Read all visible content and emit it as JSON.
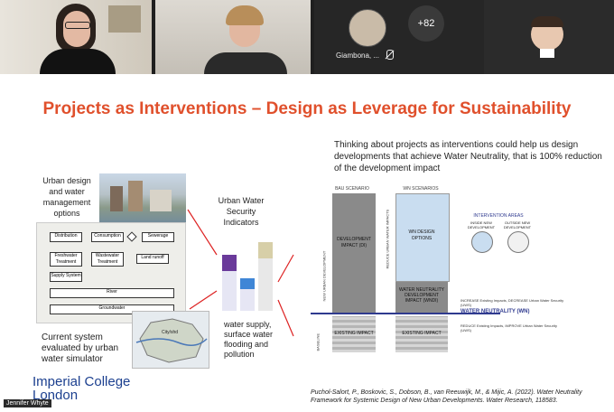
{
  "participants": {
    "others_count": "+82",
    "speaker_name": "Giambona, ...",
    "name_tag": "Jennifer Whyte"
  },
  "slide": {
    "title": "Projects as Interventions – Design as Leverage for Sustainability",
    "intro_text": "Thinking about projects as interventions could help us design developments that achieve Water Neutrality, that is 100% reduction of the development impact",
    "urban_design_label": "Urban design and water management options",
    "current_system_label": "Current system evaluated by urban water simulator",
    "indicators_title": "Urban Water Security Indicators",
    "indicators_caption": "water supply, surface water flooding and pollution",
    "flow_boxes": {
      "distribution": "Distribution",
      "consumption": "Consumption",
      "sewerage": "Sewerage",
      "freshwater": "Freshwater Treatment",
      "wastewater": "Wastewater Treatment",
      "land_runoff": "Land runoff",
      "supply_system": "Supply System",
      "river": "River",
      "groundwater": "Groundwater",
      "map_label": "City/shd"
    },
    "diagram": {
      "bau_scenario": "BAU SCENARIO",
      "wn_scenarios": "WN SCENARIOS",
      "development_impact": "DEVELOPMENT IMPACT (DI)",
      "wn_design_options": "WN DESIGN OPTIONS",
      "wn_dev_impact": "WATER NEUTRALITY DEVELOPMENT IMPACT (WNDI)",
      "existing_impact_1": "EXISTING IMPACT",
      "existing_impact_2": "EXISTING IMPACT",
      "new_urban_development": "NEW URBAN DEVELOPMENT",
      "reduce_impacts": "REDUCE URBAN WATER IMPACTS",
      "baseline": "BASELINE",
      "intervention_areas": "INTERVENTION AREAS",
      "inside_dev": "INSIDE NEW DEVELOPMENT",
      "outside_dev": "OUTSIDE NEW DEVELOPMENT",
      "wn_line_label": "WATER NEUTRALITY (WN)",
      "increase_text": "INCREASE Existing Impacts, DECREASE Urban Water Security (UWS)",
      "reduce_text": "REDUCE Existing Impacts, IMPROVE Urban Water Security (UWS)"
    },
    "citation": "Puchol-Salort, P., Boskovic, S., Dobson, B., van Reeuwijk, M., & Mijic, A. (2022). Water Neutrality Framework for Systemic Design of New Urban Developments. Water Research, 118583.",
    "logo": "Imperial College London"
  },
  "colors": {
    "title": "#e0502c",
    "accent_blue": "#2f3a8f",
    "bar_purple": "#6a3a9a",
    "bar_blue": "#3f86d6"
  }
}
